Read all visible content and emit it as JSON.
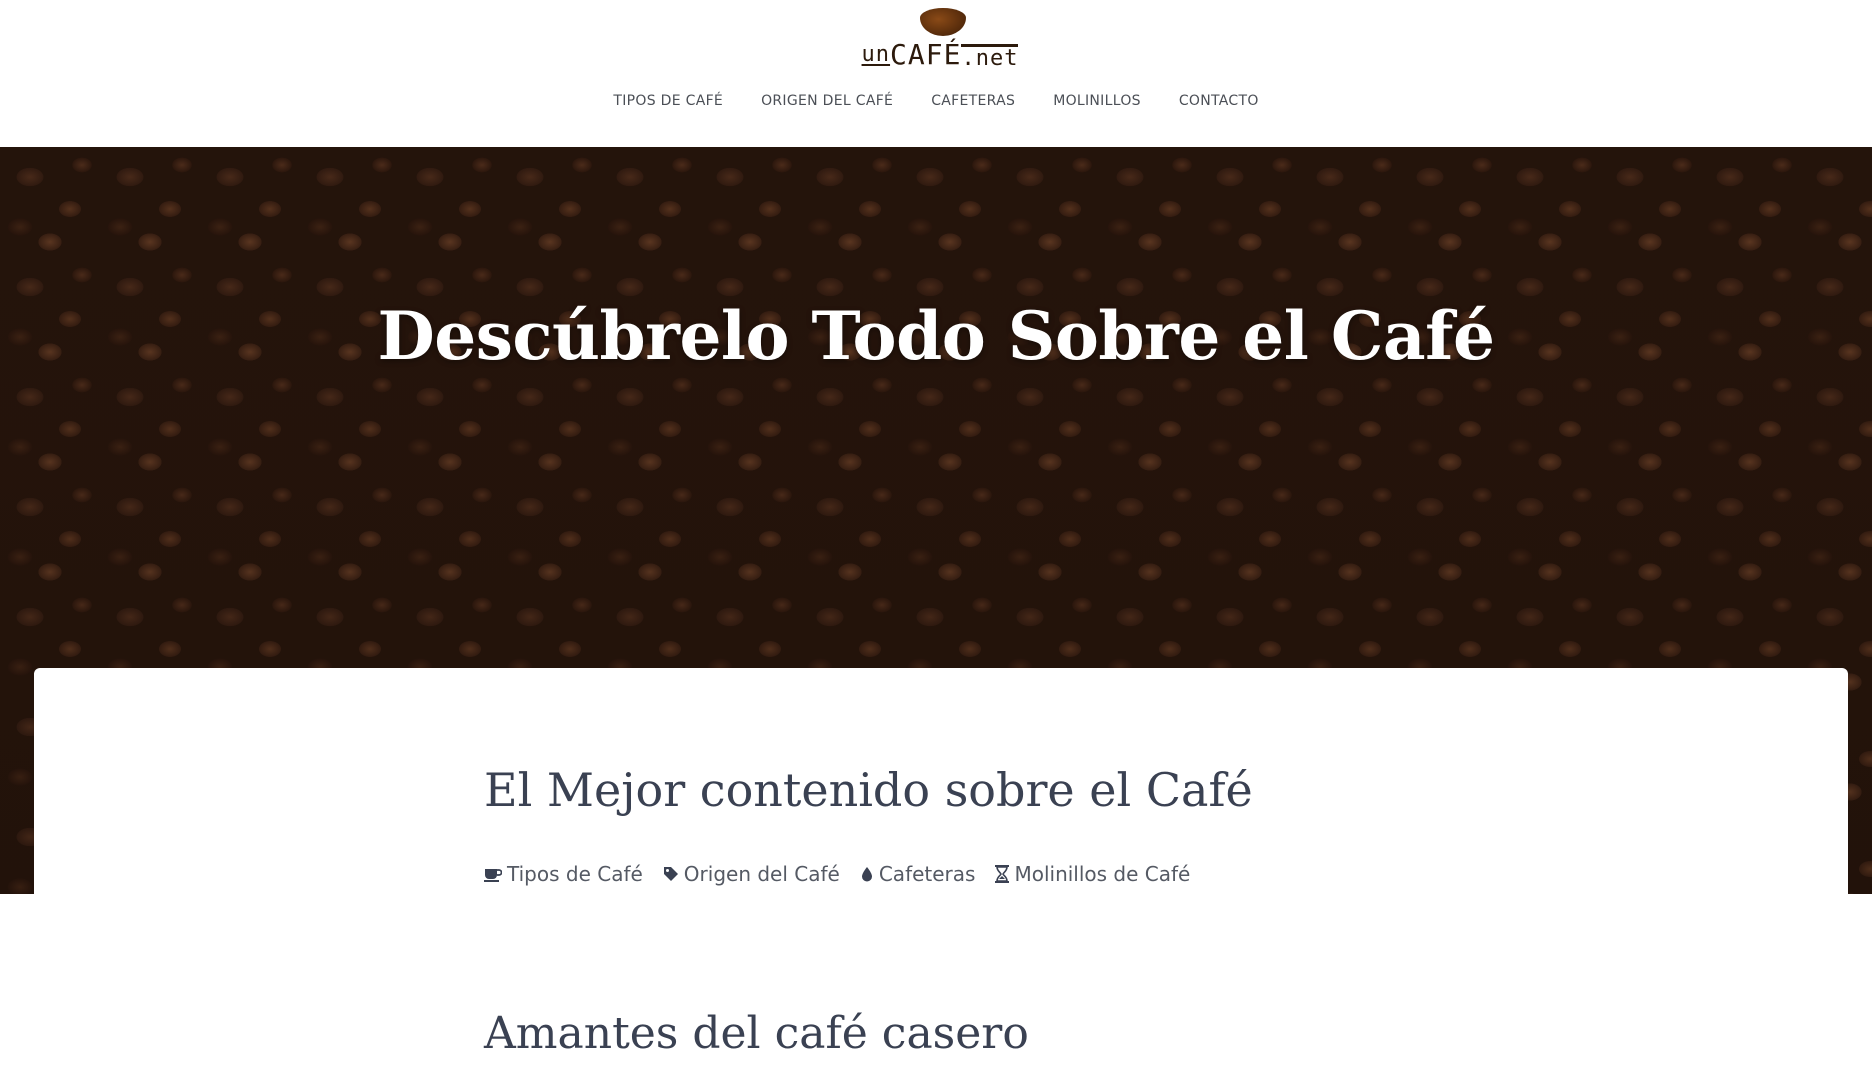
{
  "header": {
    "logo": {
      "prefix": "un",
      "main": "CAFÉ",
      "suffix": ".net"
    },
    "nav": [
      {
        "label": "TIPOS DE CAFÉ"
      },
      {
        "label": "ORIGEN DEL CAFÉ"
      },
      {
        "label": "CAFETERAS"
      },
      {
        "label": "MOLINILLOS"
      },
      {
        "label": "CONTACTO"
      }
    ]
  },
  "hero": {
    "title": "Descúbrelo Todo Sobre el Café"
  },
  "content": {
    "heading": "El Mejor contenido sobre el Café",
    "categories": [
      {
        "label": "Tipos de Café",
        "icon": "coffee-cup-icon"
      },
      {
        "label": "Origen del Café",
        "icon": "tag-icon"
      },
      {
        "label": "Cafeteras",
        "icon": "water-drop-icon"
      },
      {
        "label": "Molinillos de Café",
        "icon": "hourglass-icon"
      }
    ],
    "subheading": "Amantes del café casero"
  },
  "colors": {
    "nav_text": "#4b4f56",
    "heading": "#3a4152",
    "logo_brown": "#2c1a0c",
    "bean_brown": "#5b2e0c"
  }
}
